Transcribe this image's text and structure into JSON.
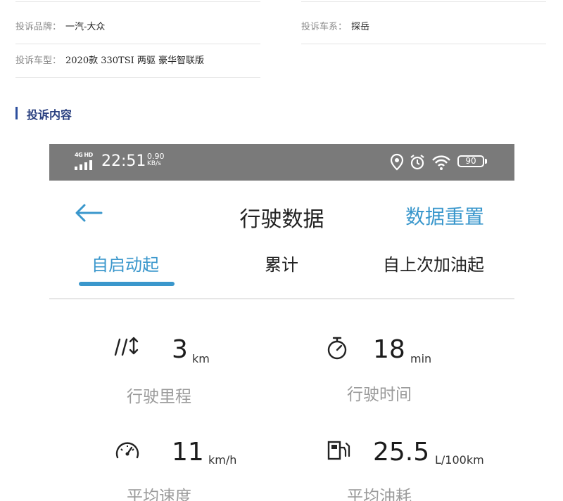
{
  "complaint": {
    "brand_label": "投诉品牌：",
    "brand_value": "一汽-大众",
    "series_label": "投诉车系：",
    "series_value": "探岳",
    "model_label": "投诉车型：",
    "model_value": "2020款 330TSI 两驱 豪华智联版",
    "content_heading": "投诉内容"
  },
  "statusbar": {
    "network_label": "4G HD",
    "time": "22:51",
    "speed_value": "0.90",
    "speed_unit": "KB/s",
    "battery": "90",
    "icons": [
      "signal-icon",
      "location-icon",
      "alarm-icon",
      "wifi-icon",
      "battery-icon"
    ]
  },
  "header": {
    "back_icon": "back-arrow-icon",
    "title": "行驶数据",
    "reset_label": "数据重置"
  },
  "tabs": [
    {
      "label": "自启动起",
      "active": true
    },
    {
      "label": "累计",
      "active": false
    },
    {
      "label": "自上次加油起",
      "active": false
    }
  ],
  "metrics": [
    {
      "icon": "road-distance-icon",
      "value": "3",
      "unit": "km",
      "label": "行驶里程"
    },
    {
      "icon": "stopwatch-icon",
      "value": "18",
      "unit": "min",
      "label": "行驶时间"
    },
    {
      "icon": "speedometer-icon",
      "value": "11",
      "unit": "km/h",
      "label": "平均速度"
    },
    {
      "icon": "fuel-pump-icon",
      "value": "25.5",
      "unit": "L/100km",
      "label": "平均油耗"
    }
  ],
  "colors": {
    "accent": "#3a97cc",
    "statusbar_bg": "#7a7a7a",
    "section_accent": "#2d4f9e"
  }
}
